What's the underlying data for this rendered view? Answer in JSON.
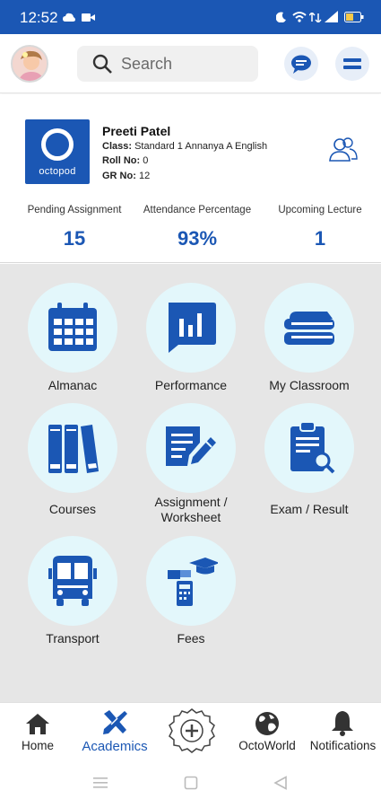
{
  "status_bar": {
    "time": "12:52"
  },
  "header": {
    "search_placeholder": "Search"
  },
  "profile": {
    "school_brand": "octopod",
    "name": "Preeti Patel",
    "class_label": "Class:",
    "class_value": "Standard 1 Annanya A English",
    "roll_label": "Roll No:",
    "roll_value": "0",
    "gr_label": "GR No:",
    "gr_value": "12"
  },
  "stats": [
    {
      "label": "Pending Assignment",
      "value": "15"
    },
    {
      "label": "Attendance Percentage",
      "value": "93%"
    },
    {
      "label": "Upcoming Lecture",
      "value": "1"
    }
  ],
  "tiles": [
    {
      "label": "Almanac",
      "icon": "calendar-icon"
    },
    {
      "label": "Performance",
      "icon": "chart-icon"
    },
    {
      "label": "My Classroom",
      "icon": "books-stack-icon"
    },
    {
      "label": "Courses",
      "icon": "binders-icon"
    },
    {
      "label_line1": "Assignment /",
      "label_line2": "Worksheet",
      "icon": "edit-document-icon"
    },
    {
      "label": "Exam / Result",
      "icon": "clipboard-search-icon"
    },
    {
      "label": "Transport",
      "icon": "bus-icon"
    },
    {
      "label": "Fees",
      "icon": "fees-icon"
    }
  ],
  "bottom_nav": [
    {
      "label": "Home",
      "icon": "home-icon"
    },
    {
      "label": "Academics",
      "icon": "academics-icon",
      "active": true
    },
    {
      "label": "",
      "icon": "add-badge-icon"
    },
    {
      "label": "OctoWorld",
      "icon": "globe-icon"
    },
    {
      "label": "Notifications",
      "icon": "bell-icon"
    }
  ],
  "colors": {
    "primary": "#1b57b4",
    "tile_bg": "#e3f7fb",
    "grid_bg": "#e6e6e6"
  }
}
